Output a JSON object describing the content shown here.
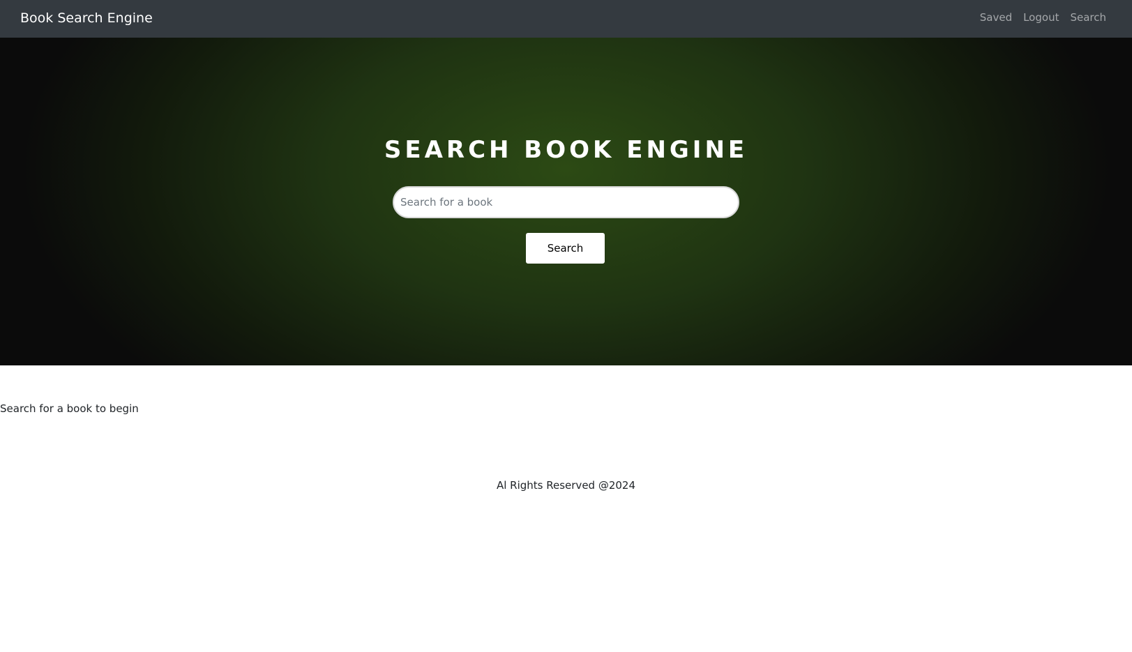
{
  "navbar": {
    "brand": "Book Search Engine",
    "links": [
      "Saved",
      "Logout",
      "Search"
    ],
    "background": "#343a40"
  },
  "hero": {
    "title": "Search Book Engine",
    "search_placeholder": "Search for a book",
    "search_value": "",
    "search_button_label": "Search",
    "accent_color": "#2c4a14"
  },
  "results": {
    "empty_message": "Search for a book to begin"
  },
  "footer": {
    "text": "Al Rights Reserved @2024"
  }
}
